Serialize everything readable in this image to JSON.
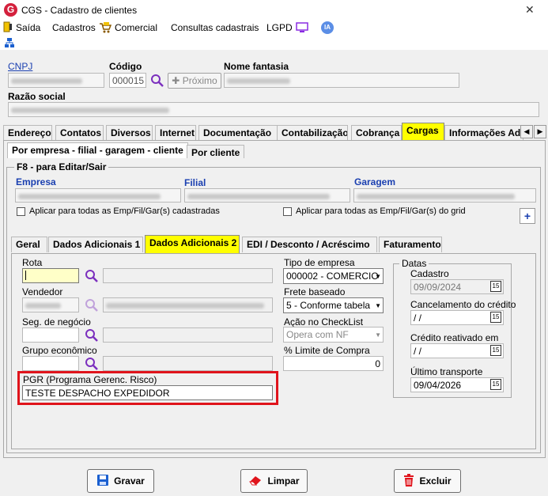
{
  "window": {
    "title": "CGS - Cadastro de clientes",
    "logo_letter": "G",
    "close_glyph": "✕"
  },
  "menu": {
    "saida": "Saída",
    "cadastros": "Cadastros",
    "comercial": "Comercial",
    "consultas": "Consultas cadastrais",
    "lgpd": "LGPD",
    "ia": "IA"
  },
  "header": {
    "cnpj_label": "CNPJ",
    "codigo_label": "Código",
    "codigo_value": "000015",
    "proximo_label": "Próximo",
    "nome_fantasia_label": "Nome fantasia",
    "razao_social_label": "Razão social"
  },
  "main_tabs": [
    "Endereço",
    "Contatos",
    "Diversos",
    "Internet",
    "Documentação",
    "Contabilização",
    "Cobrança",
    "Cargas",
    "Informações Adi"
  ],
  "main_tabs_active": "Cargas",
  "sub_tabs": [
    "Por empresa - filial - garagem - cliente",
    "Por cliente"
  ],
  "group": {
    "title": "F8 - para Editar/Sair",
    "empresa_label": "Empresa",
    "filial_label": "Filial",
    "garagem_label": "Garagem",
    "apply_all": "Aplicar para todas as Emp/Fil/Gar(s) cadastradas",
    "apply_grid": "Aplicar para todas as Emp/Fil/Gar(s) do grid",
    "add_glyph": "+"
  },
  "inner_tabs": [
    "Geral",
    "Dados Adicionais 1",
    "Dados Adicionais 2",
    "EDI / Desconto / Acréscimo",
    "Faturamento"
  ],
  "inner_tabs_active": "Dados Adicionais 2",
  "form": {
    "rota_label": "Rota",
    "vendedor_label": "Vendedor",
    "seg_negocio_label": "Seg. de negócio",
    "grupo_economico_label": "Grupo econômico",
    "pgr_label": "PGR (Programa Gerenc. Risco)",
    "pgr_value": "TESTE DESPACHO EXPEDIDOR",
    "tipo_empresa_label": "Tipo de empresa",
    "tipo_empresa_value": "000002 - COMERCIO",
    "frete_label": "Frete baseado",
    "frete_value": "5 - Conforme tabela",
    "acao_label": "Ação no CheckList",
    "acao_value": "Opera com NF",
    "limite_label": "% Limite de Compra",
    "limite_value": "0"
  },
  "datas": {
    "title": "Datas",
    "cadastro_label": "Cadastro",
    "cadastro_value": "09/09/2024",
    "cancelamento_label": "Cancelamento do crédito",
    "cancelamento_value": " / /",
    "reativado_label": "Crédito reativado em",
    "reativado_value": " / /",
    "ultimo_label": "Último transporte",
    "ultimo_value": "09/04/2026",
    "cal_glyph": "15"
  },
  "buttons": {
    "gravar": "Gravar",
    "limpar": "Limpar",
    "excluir": "Excluir"
  },
  "colors": {
    "accent_yellow": "#ffff00",
    "highlight_red": "#e0141c",
    "link_blue": "#1a3fb0",
    "search_purple": "#7b2fbe"
  }
}
